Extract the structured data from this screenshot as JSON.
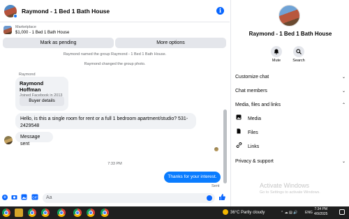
{
  "header": {
    "title": "Raymond - 1 Bed 1 Bath House"
  },
  "marketplace": {
    "label": "Marketplace",
    "item": "$1,000 - 1 Bed 1 Bath House"
  },
  "actions": {
    "mark_pending": "Mark as pending",
    "more_options": "More options"
  },
  "system_messages": [
    "Raymond named the group Raymond - 1 Bed 1 Bath House.",
    "Raymond changed the group photo."
  ],
  "messages": {
    "sender": "Raymond",
    "card": {
      "name": "Raymond Hoffman",
      "joined": "Joined Facebook in 2013",
      "button": "Buyer details"
    },
    "question": "Hello, is this a single room for rent or a full 1 bedroom apartment/studio? 531-2429548",
    "status": "Message sent",
    "time": "7:33 PM",
    "outgoing": "Thanks for your interest.",
    "sent_label": "Sent"
  },
  "composer": {
    "placeholder": "Aa"
  },
  "info_panel": {
    "name": "Raymond - 1 Bed 1 Bath House",
    "mute": "Mute",
    "search": "Search",
    "sections": {
      "customize": "Customize chat",
      "members": "Chat members",
      "media": "Media, files and links",
      "privacy": "Privacy & support"
    },
    "media_items": {
      "media": "Media",
      "files": "Files",
      "links": "Links"
    }
  },
  "watermark": {
    "title": "Activate Windows",
    "subtitle": "Go to Settings to activate Windows."
  },
  "taskbar": {
    "weather": "36°C  Partly cloudy",
    "lang": "ENG",
    "time": "7:34 PM",
    "date": "4/9/2025"
  },
  "colors": {
    "accent": "#0866ff",
    "bubble_out": "#0a7cff",
    "bubble_in": "#f0f2f5",
    "taskbar": "#1f1f1f"
  }
}
